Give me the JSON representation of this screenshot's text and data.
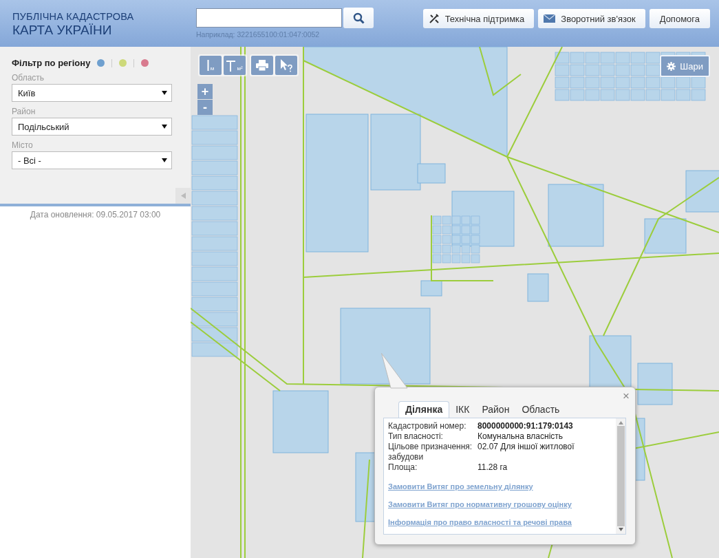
{
  "header": {
    "title_line_1": "ПУБЛІЧНА КАДАСТРОВА",
    "title_line_2": "КАРТА УКРАЇНИ",
    "search": {
      "hint": "Наприклад: 3221655100:01:047:0052"
    },
    "buttons": [
      {
        "kind": "support",
        "label": "Технічна підтримка"
      },
      {
        "kind": "feedback",
        "label": "Зворотний зв'язок"
      },
      {
        "kind": "plain",
        "label": "Допомога"
      }
    ]
  },
  "sidebar": {
    "title": "Фільтр по регіону",
    "dots": [
      {
        "color": "#6fa0cf"
      },
      {
        "color": "#cdd97a"
      },
      {
        "color": "#d87a8e"
      }
    ],
    "fields": [
      {
        "label": "Область",
        "value": "Київ"
      },
      {
        "label": "Район",
        "value": "Подільський"
      },
      {
        "label": "Місто",
        "value": "- Всі -"
      }
    ],
    "updated": "Дата оновлення: 09.05.2017 03:00"
  },
  "map": {
    "layers_button": "Шари",
    "zoom_in": "+",
    "zoom_out": "-",
    "tools": [
      "м",
      "м²"
    ]
  },
  "popup": {
    "close": "×",
    "tabs": [
      {
        "label": "Ділянка",
        "selected": true
      },
      {
        "label": "ІКК",
        "selected": false
      },
      {
        "label": "Район",
        "selected": false
      },
      {
        "label": "Область",
        "selected": false
      }
    ],
    "rows": [
      {
        "label": "Кадастровий номер:",
        "value": "8000000000:91:179:0143",
        "kind": "strong"
      },
      {
        "label": "Тип власності:",
        "value": "Комунальна власність",
        "kind": "plain"
      },
      {
        "label": "Цільове призначення:",
        "value": "02.07 Для іншої житлової",
        "continuation": "забудови",
        "kind": "plain"
      },
      {
        "label": "Площа:",
        "value": "11.28 га",
        "kind": "plain"
      }
    ],
    "links": [
      "Замовити Витяг про земельну ділянку",
      "Замовити Витяг про нормативну грошову оцінку",
      "Інформація про право власності та речові права"
    ]
  }
}
